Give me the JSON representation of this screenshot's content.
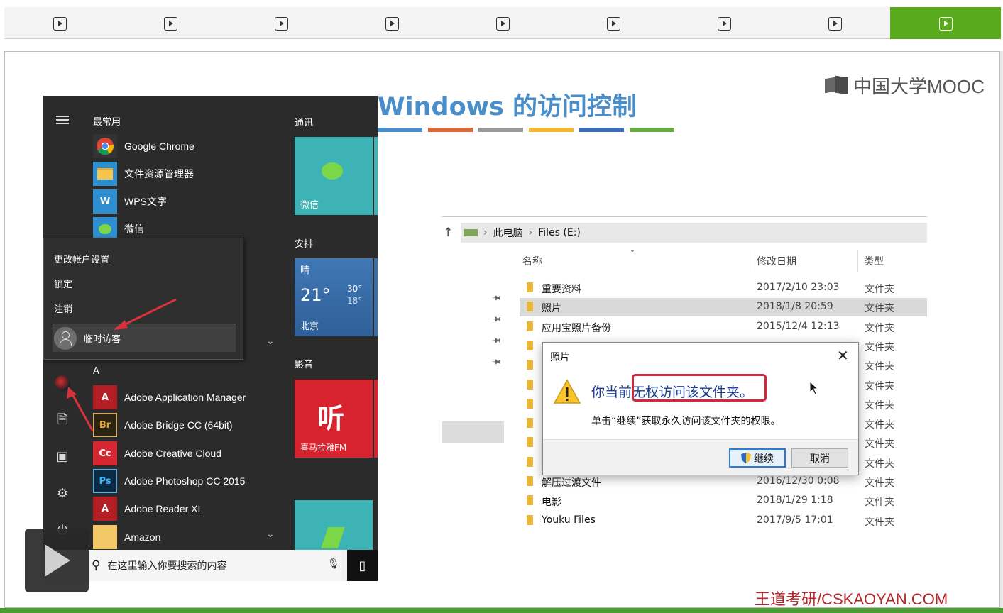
{
  "tabs": [
    {
      "icon": "play-square-icon",
      "active": false
    },
    {
      "icon": "play-square-icon",
      "active": false
    },
    {
      "icon": "play-square-icon",
      "active": false
    },
    {
      "icon": "play-square-icon",
      "active": false
    },
    {
      "icon": "play-square-icon",
      "active": false
    },
    {
      "icon": "play-square-icon",
      "active": false
    },
    {
      "icon": "play-square-icon",
      "active": false
    },
    {
      "icon": "play-square-icon",
      "active": false
    },
    {
      "icon": "play-square-icon",
      "active": true
    }
  ],
  "slide": {
    "title": "Windows 的访问控制",
    "brand": "中国大学MOOC",
    "watermark": "王道考研/CSKAOYAN.COM",
    "bar_colors": [
      "#4a8ec9",
      "#d86a3a",
      "#9a9a9a",
      "#f0b72f",
      "#3d6cb6",
      "#6aaa45"
    ]
  },
  "start_menu": {
    "most_used_heading": "最常用",
    "apps_top": [
      {
        "label": "Google Chrome",
        "icon": "chrome-icon"
      },
      {
        "label": "文件资源管理器",
        "icon": "folder-icon"
      },
      {
        "label": "WPS文字",
        "icon": "wps-icon"
      },
      {
        "label": "微信",
        "icon": "wechat-icon"
      }
    ],
    "account_menu": {
      "items": [
        "更改帐户设置",
        "锁定",
        "注销"
      ],
      "current_user": "临时访客"
    },
    "letter_heading": "A",
    "apps_a": [
      {
        "label": "Adobe Application Manager",
        "icon": "adobe-icon",
        "badge": "A"
      },
      {
        "label": "Adobe Bridge CC (64bit)",
        "icon": "bridge-icon",
        "badge": "Br"
      },
      {
        "label": "Adobe Creative Cloud",
        "icon": "creative-cloud-icon",
        "badge": "Cc"
      },
      {
        "label": "Adobe Photoshop CC 2015",
        "icon": "photoshop-icon",
        "badge": "Ps"
      },
      {
        "label": "Adobe Reader XI",
        "icon": "acrobat-icon",
        "badge": "A"
      },
      {
        "label": "Amazon",
        "icon": "amazon-icon",
        "badge": ""
      }
    ],
    "tiles": {
      "section_comm": "通讯",
      "wechat_tile": "微信",
      "section_schedule": "安排",
      "weather": {
        "condition": "晴",
        "temp": "21°",
        "high": "30°",
        "low": "18°",
        "city": "北京"
      },
      "section_media": "影音",
      "ximalaya_tile": "喜马拉雅FM",
      "ximalaya_glyph": "听"
    },
    "search_placeholder": "在这里输入你要搜索的内容"
  },
  "explorer": {
    "breadcrumb": [
      "此电脑",
      "Files (E:)"
    ],
    "columns": {
      "name": "名称",
      "date": "修改日期",
      "type": "类型"
    },
    "rows": [
      {
        "name": "重要资料",
        "date": "2017/2/10 23:03",
        "type": "文件夹",
        "selected": false
      },
      {
        "name": "照片",
        "date": "2018/1/8 20:59",
        "type": "文件夹",
        "selected": true
      },
      {
        "name": "应用宝照片备份",
        "date": "2015/12/4 12:13",
        "type": "文件夹",
        "selected": false
      },
      {
        "name": "",
        "date": "",
        "type": "文件夹",
        "selected": false
      },
      {
        "name": "",
        "date": "",
        "type": "文件夹",
        "selected": false
      },
      {
        "name": "",
        "date": "",
        "type": "文件夹",
        "selected": false
      },
      {
        "name": "",
        "date": "",
        "type": "文件夹",
        "selected": false
      },
      {
        "name": "",
        "date": "",
        "type": "文件夹",
        "selected": false
      },
      {
        "name": "",
        "date": "",
        "type": "文件夹",
        "selected": false
      },
      {
        "name": "",
        "date": "",
        "type": "文件夹",
        "selected": false
      },
      {
        "name": "解压过渡文件",
        "date": "2016/12/30 0:08",
        "type": "文件夹",
        "selected": false
      },
      {
        "name": "电影",
        "date": "2018/1/29 1:18",
        "type": "文件夹",
        "selected": false
      },
      {
        "name": "Youku Files",
        "date": "2017/9/5 17:01",
        "type": "文件夹",
        "selected": false
      }
    ]
  },
  "dialog": {
    "title": "照片",
    "main_message": "你当前无权访问该文件夹。",
    "sub_message": "单击“继续”获取永久访问该文件夹的权限。",
    "continue_label": "继续",
    "cancel_label": "取消"
  }
}
